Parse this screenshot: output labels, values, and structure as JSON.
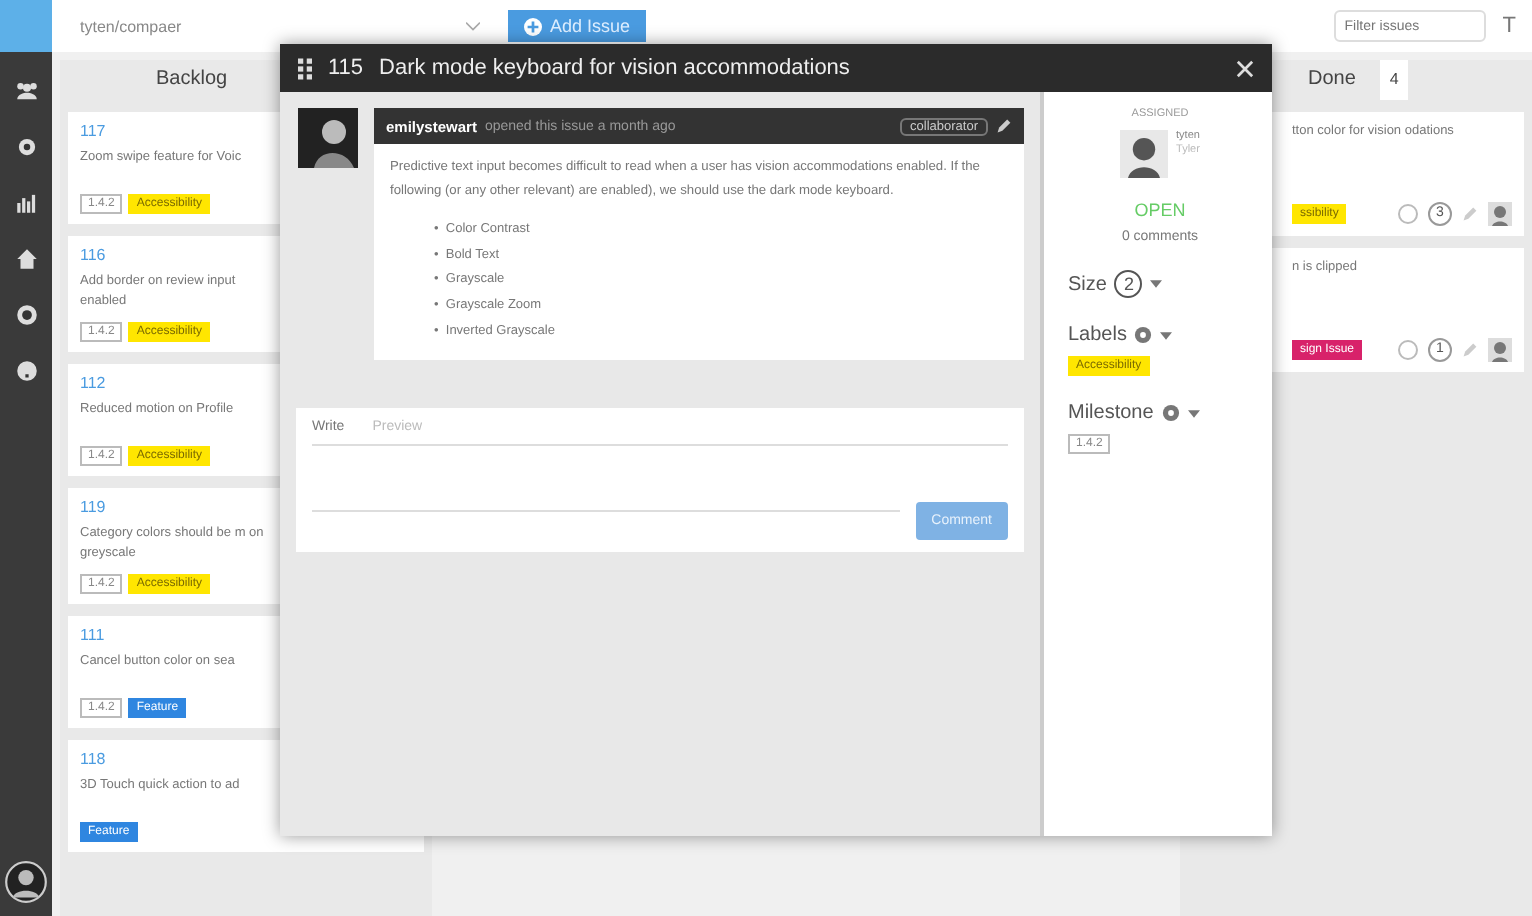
{
  "repo_select": {
    "value": "tyten/compaer"
  },
  "add_button": "Add Issue",
  "search": {
    "placeholder": "Filter issues"
  },
  "filter_label": "T",
  "backlog": {
    "title": "Backlog",
    "cards": [
      {
        "number": "117",
        "title": "Zoom swipe feature for Voic",
        "labels": [
          {
            "text": "1.4.2",
            "kind": "milestone"
          },
          {
            "text": "Accessibility",
            "kind": "tag",
            "color": "#ffe600"
          }
        ]
      },
      {
        "number": "116",
        "title": "Add border on review input enabled",
        "labels": [
          {
            "text": "1.4.2",
            "kind": "milestone"
          },
          {
            "text": "Accessibility",
            "kind": "tag",
            "color": "#ffe600"
          }
        ]
      },
      {
        "number": "112",
        "title": "Reduced motion on Profile",
        "labels": [
          {
            "text": "1.4.2",
            "kind": "milestone"
          },
          {
            "text": "Accessibility",
            "kind": "tag",
            "color": "#ffe600"
          }
        ]
      },
      {
        "number": "119",
        "title": "Category colors should be m on greyscale",
        "labels": [
          {
            "text": "1.4.2",
            "kind": "milestone"
          },
          {
            "text": "Accessibility",
            "kind": "tag",
            "color": "#ffe600"
          }
        ]
      },
      {
        "number": "111",
        "title": "Cancel button color on sea",
        "labels": [
          {
            "text": "1.4.2",
            "kind": "milestone"
          },
          {
            "text": "Feature",
            "kind": "tag",
            "color": "#2f86e0"
          }
        ]
      },
      {
        "number": "118",
        "title": "3D Touch quick action to ad",
        "labels": [
          {
            "text": "Feature",
            "kind": "tag",
            "color": "#2f86e0"
          }
        ]
      }
    ]
  },
  "done": {
    "title": "Done",
    "count": "4",
    "cards": [
      {
        "title": "tton color for vision odations",
        "label": {
          "text": "ssibility",
          "color": "#ffe600"
        },
        "size": "3"
      },
      {
        "title": "n is clipped",
        "label": {
          "text": "sign Issue",
          "color": "#d8226a"
        },
        "size": "1"
      }
    ]
  },
  "modal": {
    "number": "115",
    "title": "Dark mode keyboard for vision accommodations",
    "comment": {
      "author": "emilystewart",
      "action": "opened this issue a month ago",
      "role": "collaborator",
      "body": "Predictive text input becomes difficult to read when a user has vision accommodations enabled. If the following (or any other relevant) are enabled), we should use the dark mode keyboard.",
      "bullet": "•",
      "items": [
        "Color Contrast",
        "Bold Text",
        "Grayscale",
        "Grayscale Zoom",
        "Inverted Grayscale"
      ]
    },
    "tabs": [
      {
        "label": "Write",
        "selected": true
      },
      {
        "label": "Preview",
        "selected": false
      }
    ],
    "submit": "Comment",
    "assigned_heading": "ASSIGNED",
    "assignee": {
      "login": "tyten",
      "name": "Tyler"
    },
    "state": "OPEN",
    "comments": "0 comments",
    "size_label": "Size",
    "size": "2",
    "labels_heading": "Labels",
    "label": {
      "text": "Accessibility",
      "color": "#ffe600"
    },
    "milestone_heading": "Milestone",
    "milestone": "1.4.2"
  }
}
